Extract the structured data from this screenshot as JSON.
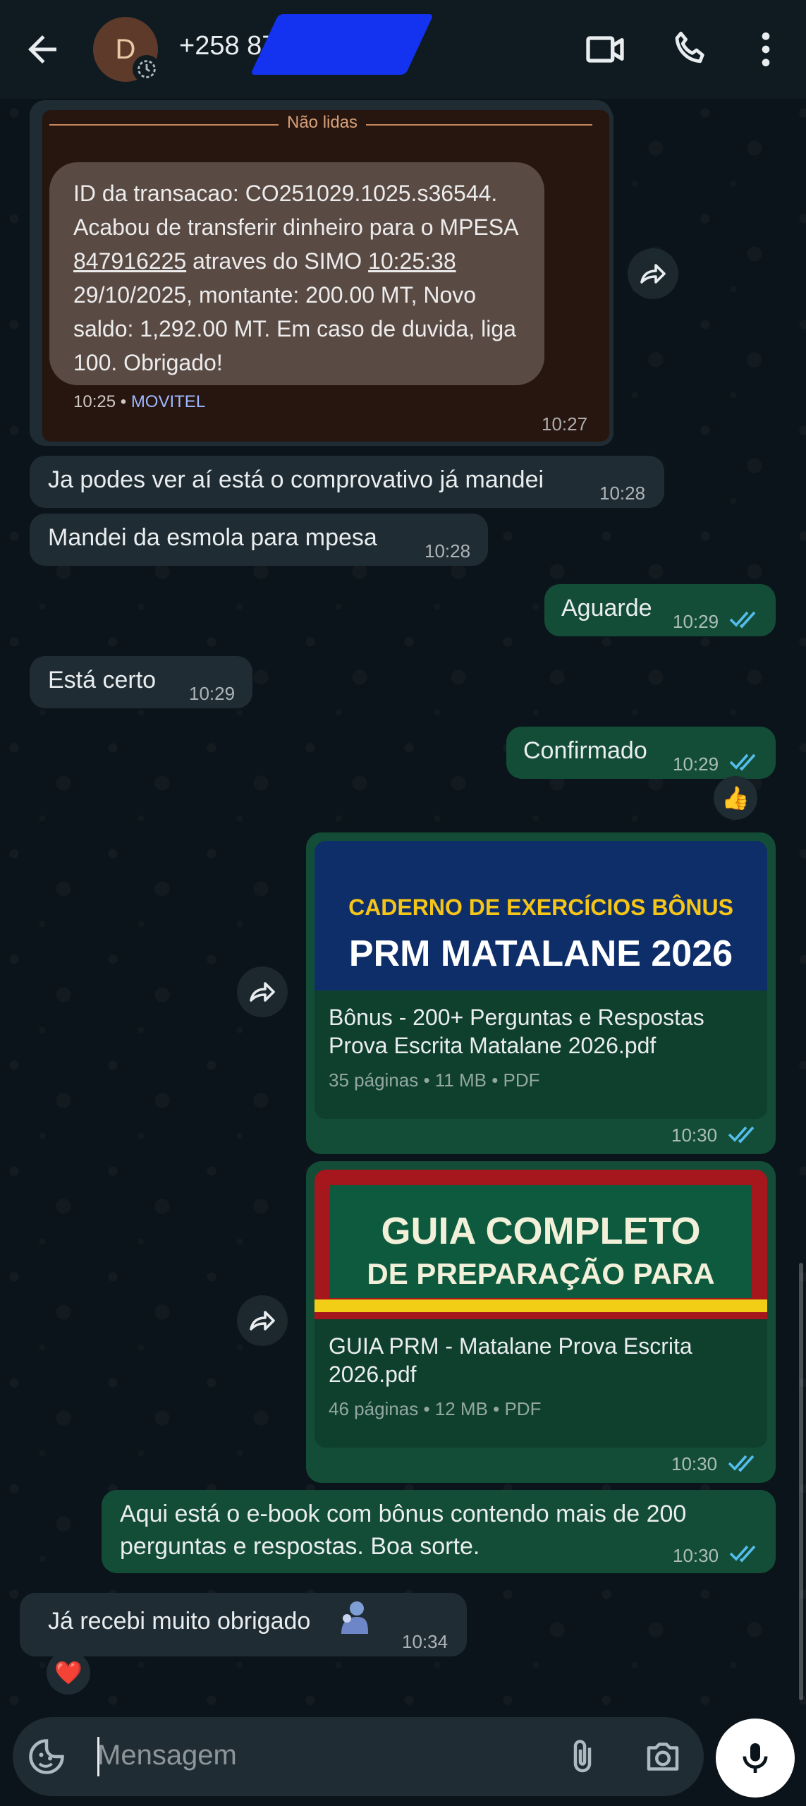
{
  "header": {
    "avatar_letter": "D",
    "contact_name": "+258 87",
    "icons": [
      "back-arrow-icon",
      "video-call-icon",
      "phone-call-icon",
      "more-vert-icon"
    ]
  },
  "sms_screenshot": {
    "unread_label": "Não lidas",
    "lines": [
      "ID da transacao: CO251029.1025.s36544.",
      "Acabou de transferir dinheiro para o MPESA",
      "847916225",
      " atraves do SIMO ",
      "10:25:38",
      "29/10/2025, montante: 200.00 MT, Novo",
      "saldo: 1,292.00 MT. Em caso de duvida, liga",
      "100. Obrigado!"
    ],
    "sms_time": "10:25",
    "separator": "•",
    "carrier": "MOVITEL",
    "bubble_time": "10:27"
  },
  "messages": [
    {
      "text": "Ja podes ver aí está o comprovativo já mandei",
      "time": "10:28"
    },
    {
      "text": "Mandei da esmola para mpesa",
      "time": "10:28"
    },
    {
      "text": "Aguarde",
      "time": "10:29"
    },
    {
      "text": "Está certo",
      "time": "10:29"
    },
    {
      "text": "Confirmado",
      "time": "10:29",
      "reaction": "👍"
    },
    {
      "text": "Aqui está o e-book com bônus contendo mais de 200 perguntas e respostas. Boa sorte.",
      "time": "10:30"
    },
    {
      "text": "Já recebi muito obrigado",
      "time": "10:34",
      "reaction": "❤️"
    }
  ],
  "documents": [
    {
      "thumb_line1": "CADERNO DE EXERCÍCIOS BÔNUS",
      "thumb_line2": "PRM MATALANE 2026",
      "title": "Bônus - 200+ Perguntas e Respostas Prova Escrita Matalane 2026.pdf",
      "info": "35 páginas • 11 MB • PDF",
      "time": "10:30"
    },
    {
      "thumb_line1": "GUIA COMPLETO",
      "thumb_line2": "DE PREPARAÇÃO PARA",
      "title": "GUIA PRM - Matalane Prova Escrita 2026.pdf",
      "info": "46 páginas • 12 MB • PDF",
      "time": "10:30"
    }
  ],
  "input": {
    "placeholder": "Mensagem"
  },
  "colors": {
    "background": "#0b141a",
    "incoming": "#1f2c33",
    "outgoing": "#144d37",
    "read_ticks": "#53bdeb"
  }
}
